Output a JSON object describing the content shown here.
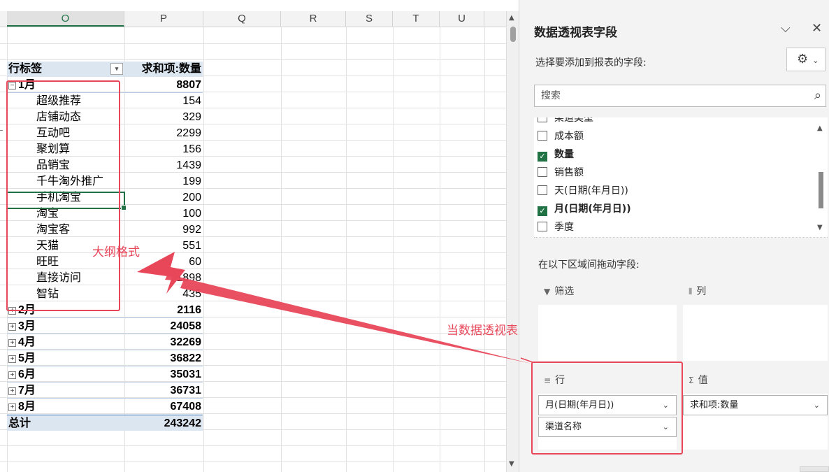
{
  "sheet": {
    "columns": [
      "O",
      "P",
      "Q",
      "R",
      "S",
      "T",
      "U"
    ],
    "pivot": {
      "header_label": "行标签",
      "header_value": "求和项:数量",
      "rows": [
        {
          "label": "1月",
          "value": "8807",
          "kind": "month",
          "expand": "⊟"
        },
        {
          "label": "超级推荐",
          "value": "154",
          "kind": "child"
        },
        {
          "label": "店铺动态",
          "value": "329",
          "kind": "child"
        },
        {
          "label": "互动吧",
          "value": "2299",
          "kind": "child"
        },
        {
          "label": "聚划算",
          "value": "156",
          "kind": "child"
        },
        {
          "label": "品销宝",
          "value": "1439",
          "kind": "child"
        },
        {
          "label": "千牛淘外推广",
          "value": "199",
          "kind": "child"
        },
        {
          "label": "手机淘宝",
          "value": "200",
          "kind": "child"
        },
        {
          "label": "淘宝",
          "value": "100",
          "kind": "child"
        },
        {
          "label": "淘宝客",
          "value": "992",
          "kind": "child"
        },
        {
          "label": "天猫",
          "value": "551",
          "kind": "child"
        },
        {
          "label": "旺旺",
          "value": "60",
          "kind": "child"
        },
        {
          "label": "直接访问",
          "value": "1898",
          "kind": "child"
        },
        {
          "label": "智钻",
          "value": "435",
          "kind": "child"
        },
        {
          "label": "2月",
          "value": "2116",
          "kind": "month",
          "expand": "⊞"
        },
        {
          "label": "3月",
          "value": "24058",
          "kind": "month",
          "expand": "⊞"
        },
        {
          "label": "4月",
          "value": "32269",
          "kind": "month",
          "expand": "⊞"
        },
        {
          "label": "5月",
          "value": "36822",
          "kind": "month",
          "expand": "⊞"
        },
        {
          "label": "6月",
          "value": "35031",
          "kind": "month",
          "expand": "⊞"
        },
        {
          "label": "7月",
          "value": "36731",
          "kind": "month",
          "expand": "⊞"
        },
        {
          "label": "8月",
          "value": "67408",
          "kind": "month",
          "expand": "⊞"
        },
        {
          "label": "总计",
          "value": "243242",
          "kind": "total"
        }
      ]
    }
  },
  "annotations": {
    "outline_note": "大纲格式",
    "multi_row_note": "当数据透视表是多行时，显示格式是大纲格式",
    "color": "#e8475a"
  },
  "pane": {
    "title": "数据透视表字段",
    "collapse_icon": "chevron-down-icon",
    "close_icon": "close-icon",
    "choose_fields_label": "选择要添加到报表的字段:",
    "search_placeholder": "搜索",
    "fields": [
      {
        "name": "渠道类型",
        "checked": false
      },
      {
        "name": "成本额",
        "checked": false
      },
      {
        "name": "数量",
        "checked": true
      },
      {
        "name": "销售额",
        "checked": false
      },
      {
        "name": "天(日期(年月日))",
        "checked": false
      },
      {
        "name": "月(日期(年月日))",
        "checked": true
      },
      {
        "name": "季度",
        "checked": false
      }
    ],
    "drag_label": "在以下区域间拖动字段:",
    "areas": {
      "filter_label": "筛选",
      "columns_label": "列",
      "rows_label": "行",
      "values_label": "值",
      "row_items": [
        "月(日期(年月日))",
        "渠道名称"
      ],
      "value_items": [
        "求和项:数量"
      ]
    }
  },
  "colors": {
    "excel_green": "#217346",
    "pivot_header_blue": "#dce6f1"
  }
}
